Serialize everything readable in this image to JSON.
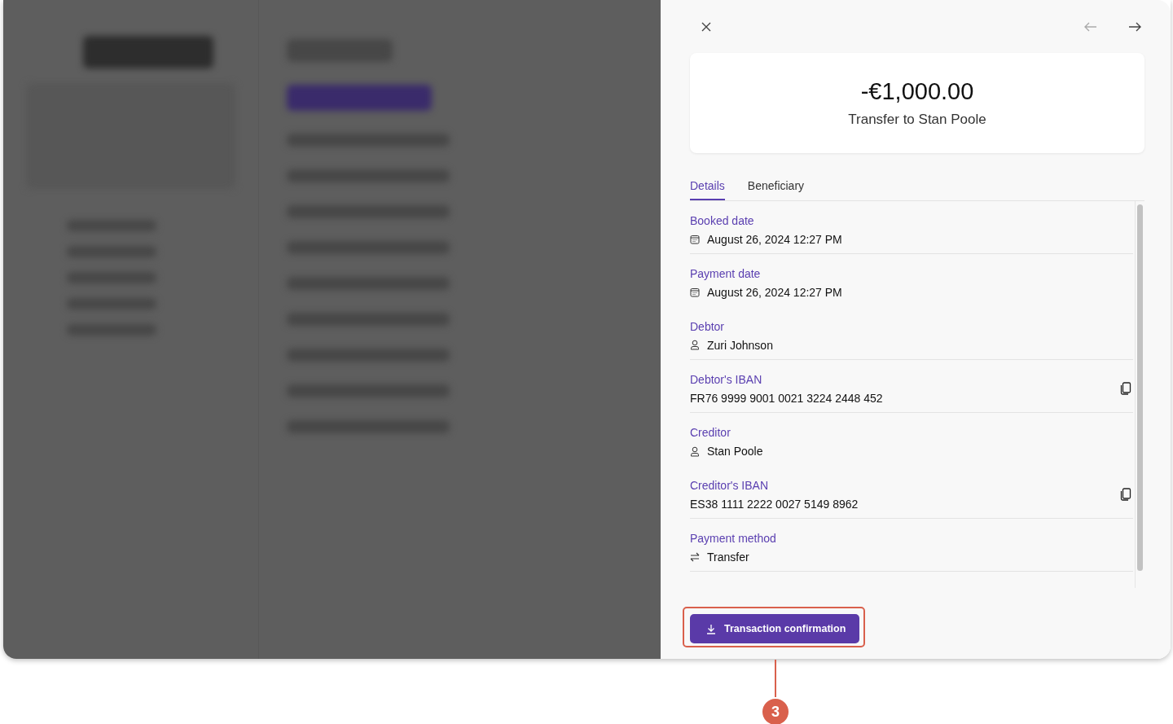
{
  "panel": {
    "amount": "-€1,000.00",
    "title": "Transfer to Stan Poole",
    "tabs": [
      {
        "label": "Details",
        "selected": true
      },
      {
        "label": "Beneficiary",
        "selected": false
      }
    ],
    "details": [
      {
        "label": "Booked date",
        "value": "August 26, 2024 12:27 PM",
        "kind": "date",
        "divider": true
      },
      {
        "label": "Payment date",
        "value": "August 26, 2024 12:27 PM",
        "kind": "date",
        "divider": false
      },
      {
        "label": "Debtor",
        "value": "Zuri Johnson",
        "kind": "person",
        "divider": true
      },
      {
        "label": "Debtor's IBAN",
        "value": "FR76 9999 9001 0021 3224 2448 452",
        "kind": "iban",
        "divider": true
      },
      {
        "label": "Creditor",
        "value": "Stan Poole",
        "kind": "person",
        "divider": false
      },
      {
        "label": "Creditor's IBAN",
        "value": "ES38 1111 2222 0027 5149 8962",
        "kind": "iban",
        "divider": true
      },
      {
        "label": "Payment method",
        "value": "Transfer",
        "kind": "method",
        "divider": true
      }
    ],
    "download_button": "Transaction confirmation"
  },
  "callout": {
    "number": "3"
  }
}
